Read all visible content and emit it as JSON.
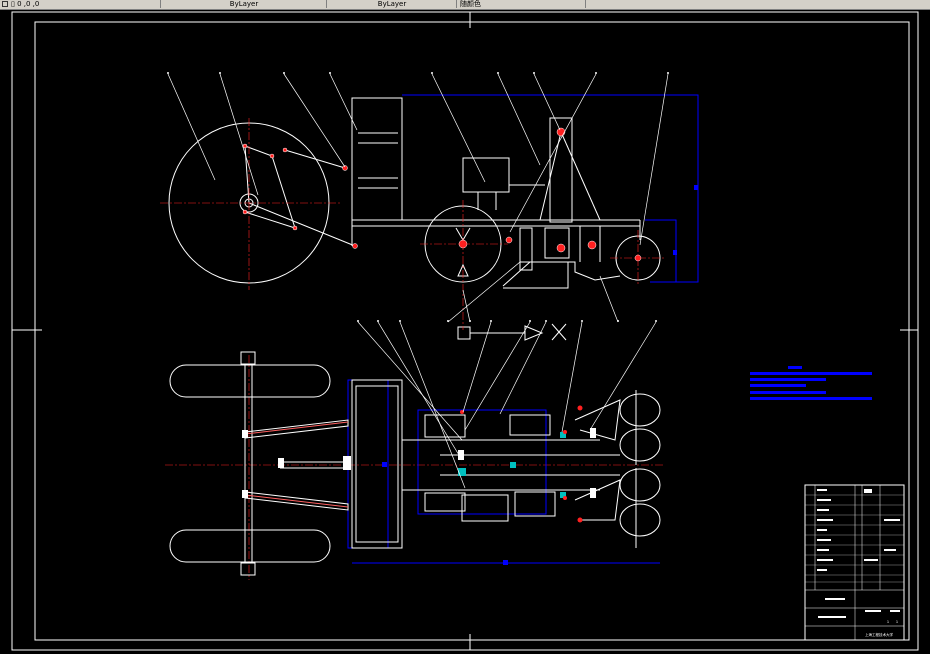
{
  "toolbar": {
    "cell_1": "▯ 0 ,0 ,0",
    "cell_2": "ByLayer",
    "cell_3": "ByLayer",
    "cell_4": "随颜色"
  },
  "drawing": {
    "colors": {
      "background": "#000000",
      "linework": "#ffffff",
      "dimension": "#0000ff",
      "centerline": "#ff0000",
      "highlight": "#ff3030"
    }
  },
  "title_block": {
    "school": "上海工程技术大学",
    "sheet_count": "1",
    "sheet_no": "1"
  }
}
